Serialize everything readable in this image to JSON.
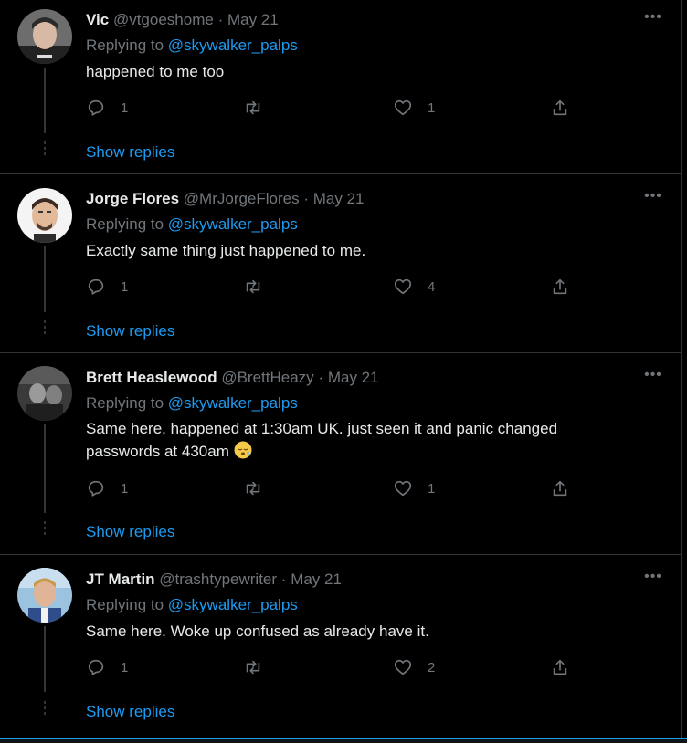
{
  "replies": [
    {
      "name": "Vic",
      "handle": "@vtgoeshome",
      "separator": "·",
      "date": "May 21",
      "replying_prefix": "Replying to",
      "replying_to": "@skywalker_palps",
      "text": "happened to me too",
      "reply_count": "1",
      "retweet_count": "",
      "like_count": "1",
      "show_replies": "Show replies"
    },
    {
      "name": "Jorge Flores",
      "handle": "@MrJorgeFlores",
      "separator": "·",
      "date": "May 21",
      "replying_prefix": "Replying to",
      "replying_to": "@skywalker_palps",
      "text": "Exactly same thing just happened to me.",
      "reply_count": "1",
      "retweet_count": "",
      "like_count": "4",
      "show_replies": "Show replies"
    },
    {
      "name": "Brett Heaslewood",
      "handle": "@BrettHeazy",
      "separator": "·",
      "date": "May 21",
      "replying_prefix": "Replying to",
      "replying_to": "@skywalker_palps",
      "text_line1": "Same here, happened at 1:30am UK. just seen it and panic changed",
      "text_line2": "passwords at 430am",
      "emoji": "sleeping-face-emoji",
      "reply_count": "1",
      "retweet_count": "",
      "like_count": "1",
      "show_replies": "Show replies"
    },
    {
      "name": "JT Martin",
      "handle": "@trashtypewriter",
      "separator": "·",
      "date": "May 21",
      "replying_prefix": "Replying to",
      "replying_to": "@skywalker_palps",
      "text": "Same here. Woke up confused as already have it.",
      "reply_count": "1",
      "retweet_count": "",
      "like_count": "2",
      "show_replies": "Show replies"
    }
  ],
  "more_glyph": "•••",
  "icons": {
    "reply": "reply-icon",
    "retweet": "retweet-icon",
    "like": "heart-icon",
    "share": "share-icon",
    "more": "more-icon"
  },
  "colors": {
    "background": "#000000",
    "accent": "#1d9bf0",
    "text_primary": "#e7e9ea",
    "text_secondary": "#71767b",
    "divider": "#2f3336"
  }
}
